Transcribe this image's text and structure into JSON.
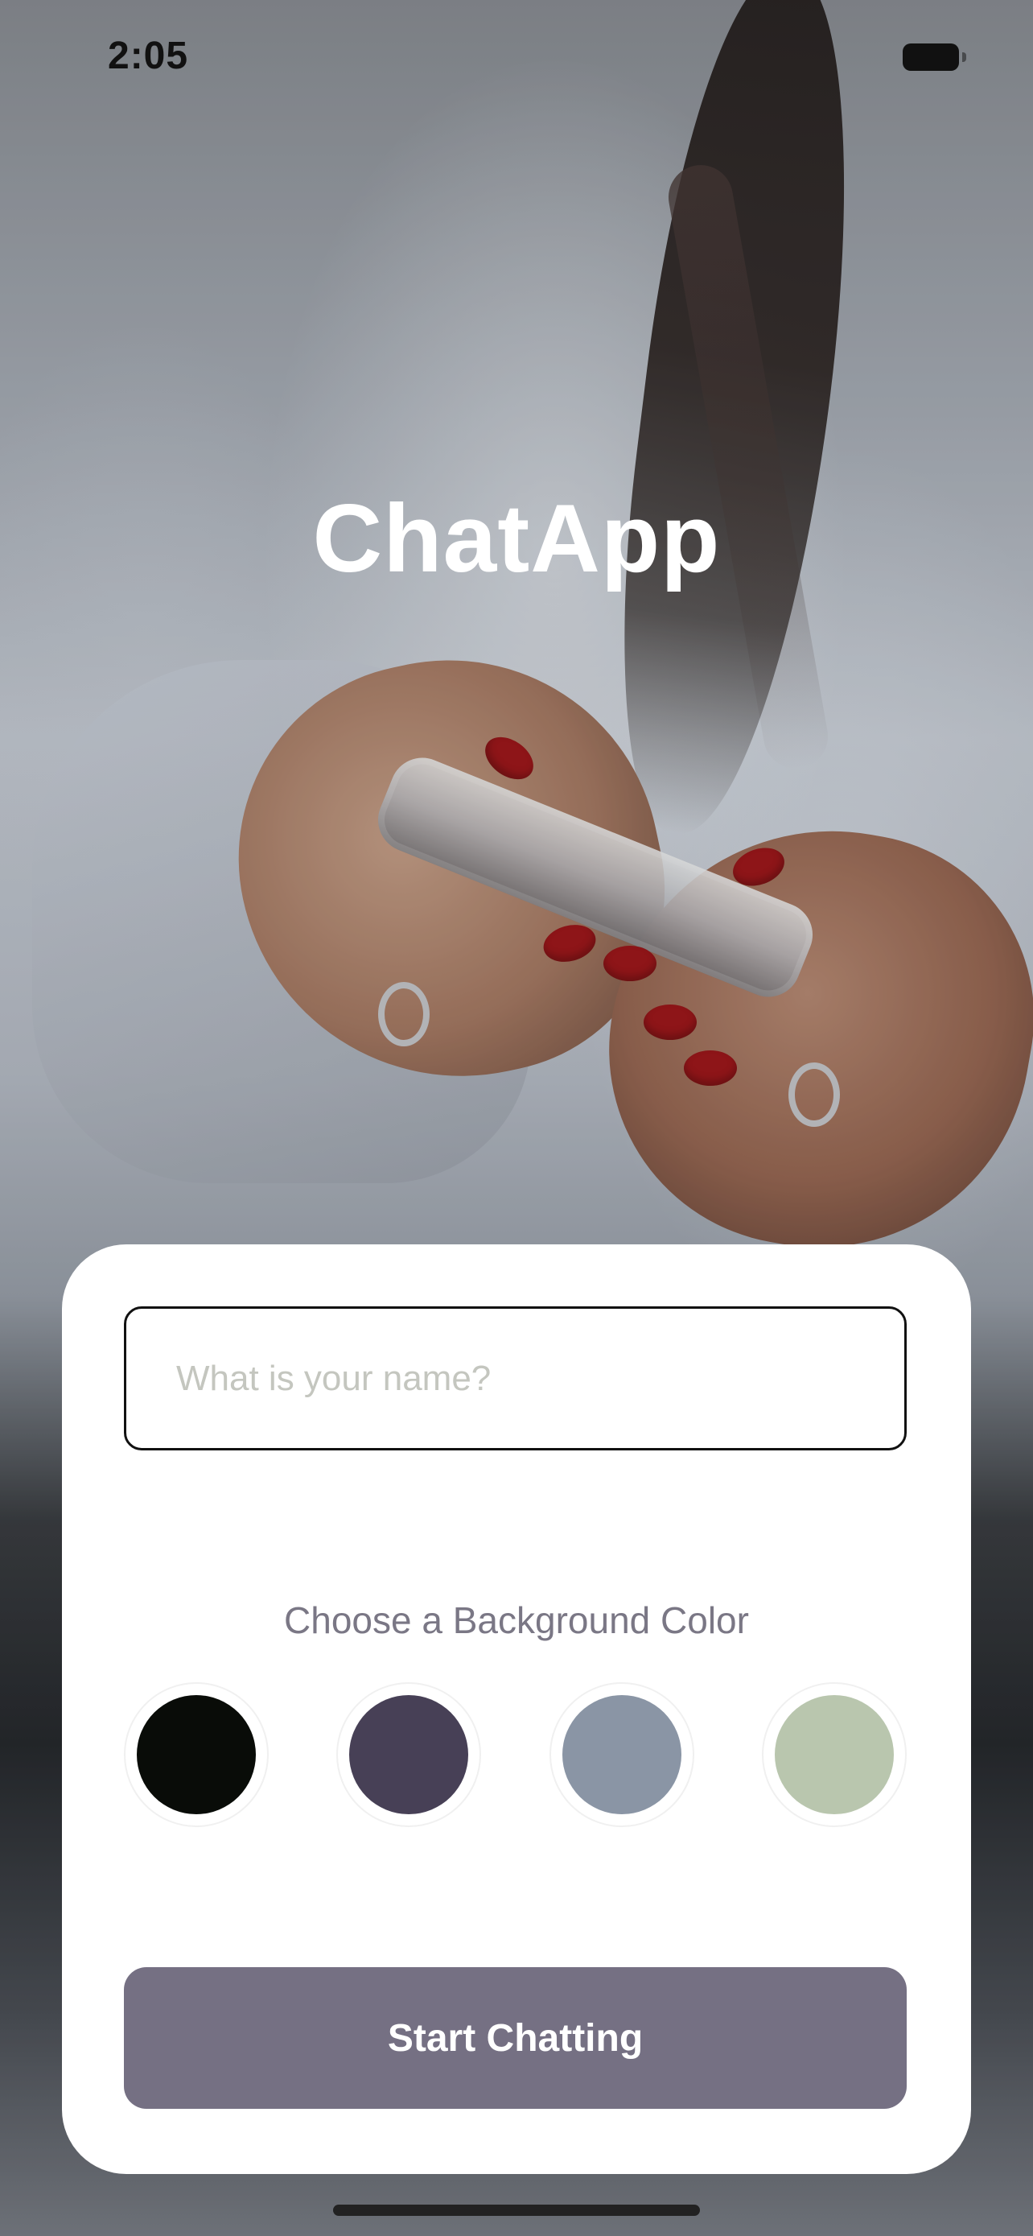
{
  "status_bar": {
    "time": "2:05",
    "battery_icon": "battery-icon"
  },
  "app": {
    "title": "ChatApp"
  },
  "form": {
    "name_placeholder": "What is your name?",
    "name_value": "",
    "color_prompt": "Choose a Background Color",
    "colors": [
      "#090C08",
      "#474056",
      "#8A95A5",
      "#B9C6AE"
    ],
    "start_label": "Start Chatting",
    "button_color": "#757083"
  }
}
